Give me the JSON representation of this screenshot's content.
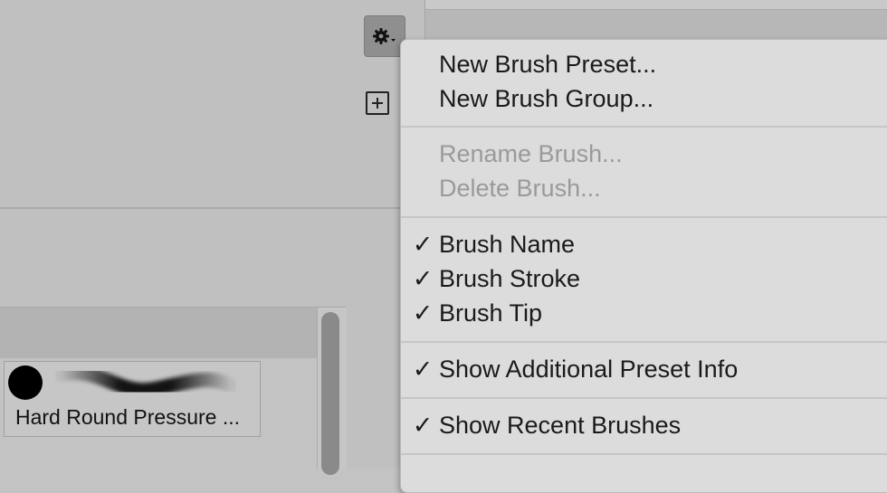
{
  "brush_panel": {
    "brush_item": {
      "label": "Hard Round Pressure ..."
    }
  },
  "menu": {
    "items": [
      {
        "label": "New Brush Preset...",
        "checked": false,
        "disabled": false
      },
      {
        "label": "New Brush Group...",
        "checked": false,
        "disabled": false
      },
      {
        "label": "Rename Brush...",
        "checked": false,
        "disabled": true
      },
      {
        "label": "Delete Brush...",
        "checked": false,
        "disabled": true
      },
      {
        "label": "Brush Name",
        "checked": true,
        "disabled": false
      },
      {
        "label": "Brush Stroke",
        "checked": true,
        "disabled": false
      },
      {
        "label": "Brush Tip",
        "checked": true,
        "disabled": false
      },
      {
        "label": "Show Additional Preset Info",
        "checked": true,
        "disabled": false
      },
      {
        "label": "Show Recent Brushes",
        "checked": true,
        "disabled": false
      }
    ],
    "check_glyph": "✓"
  },
  "colors": {
    "menu_bg": "#dcdcdc",
    "disabled_text": "#9a9a9a",
    "gear_button_bg": "#8f8f8f"
  }
}
